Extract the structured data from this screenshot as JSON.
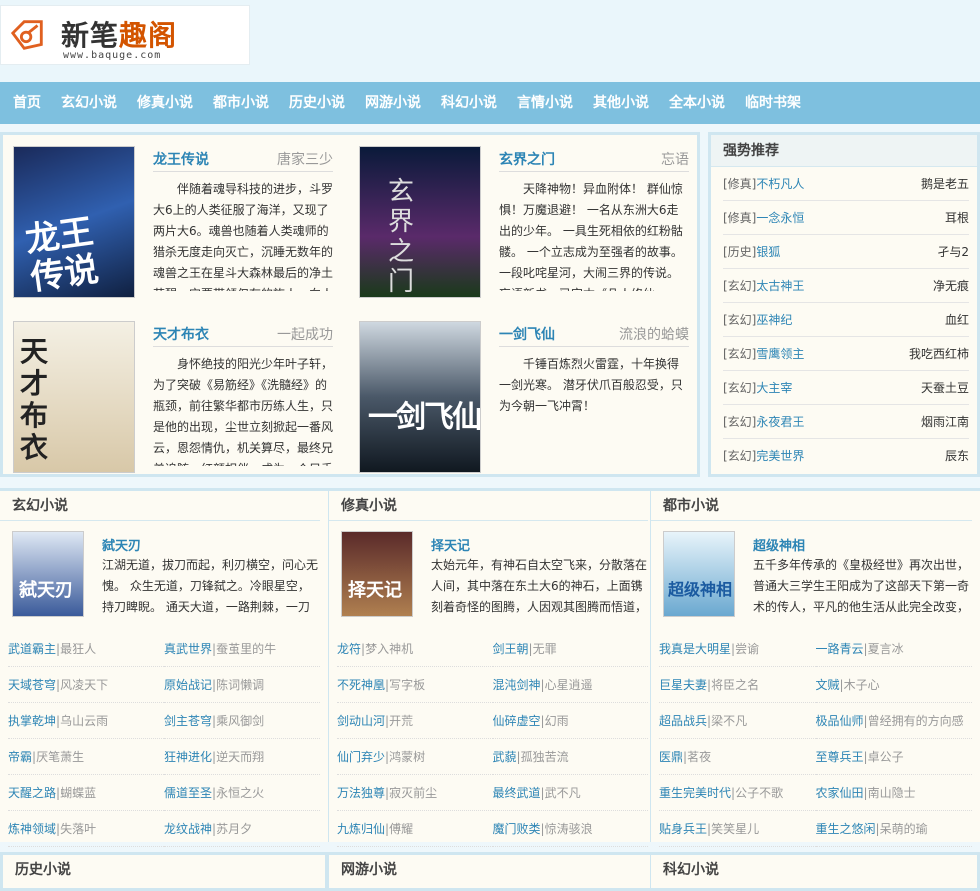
{
  "logo": {
    "text_a": "新笔",
    "text_b": "趣阁",
    "url": "www.baquge.com"
  },
  "nav": [
    "首页",
    "玄幻小说",
    "修真小说",
    "都市小说",
    "历史小说",
    "网游小说",
    "科幻小说",
    "言情小说",
    "其他小说",
    "全本小说",
    "临时书架"
  ],
  "featured": [
    {
      "title": "龙王传说",
      "author": "唐家三少",
      "desc": "伴随着魂导科技的进步，斗罗大6上的人类征服了海洋，又现了两片大6。魂兽也随着人类魂师的猎杀无度走向灭亡，沉睡无数年的魂兽之王在星斗大森林最后的净土苏醒，它要带领仅存的族人，向人类"
    },
    {
      "title": "玄界之门",
      "author": "忘语",
      "desc": "天降神物！异血附体！ 群仙惊惧！万魔退避！ 一名从东洲大6走出的少年。 一具生死相依的红粉骷髅。 一个立志成为至强者的故事。 一段叱咤星河，大闹三界的传说。 忘语新书，已完本《凡人修仙"
    },
    {
      "title": "天才布衣",
      "author": "一起成功",
      "desc": "身怀绝技的阳光少年叶子轩，为了突破《易筋经》《洗髓经》的瓶颈，前往繁华都市历练人生，只是他的出现，尘世立刻掀起一番风云，恩怨情仇，机关算尽，最终兄弟追随，红颜相伴，成为一个只手"
    },
    {
      "title": "一剑飞仙",
      "author": "流浪的蛤蟆",
      "desc": "千锤百炼烈火雷霆，十年换得一剑光寒。 潜牙伏爪百般忍受，只为今朝一飞冲霄！"
    }
  ],
  "recommend": {
    "heading": "强势推荐",
    "items": [
      {
        "tag": "[修真]",
        "name": "不朽凡人",
        "author": "鹅是老五"
      },
      {
        "tag": "[修真]",
        "name": "一念永恒",
        "author": "耳根"
      },
      {
        "tag": "[历史]",
        "name": "银狐",
        "author": "孑与2"
      },
      {
        "tag": "[玄幻]",
        "name": "太古神王",
        "author": "净无痕"
      },
      {
        "tag": "[玄幻]",
        "name": "巫神纪",
        "author": "血红"
      },
      {
        "tag": "[玄幻]",
        "name": "雪鹰领主",
        "author": "我吃西红柿"
      },
      {
        "tag": "[玄幻]",
        "name": "大主宰",
        "author": "天蚕土豆"
      },
      {
        "tag": "[玄幻]",
        "name": "永夜君王",
        "author": "烟雨江南"
      },
      {
        "tag": "[玄幻]",
        "name": "完美世界",
        "author": "辰东"
      }
    ]
  },
  "categories": [
    {
      "heading": "玄幻小说",
      "top": {
        "title": "弑天刃",
        "desc": "江湖无道，拔刀而起，利刃横空，问心无愧。 众生无道，刀锋弑之。冷眼星空，持刀睥睨。 通天大道，一路荆棘，一刀"
      },
      "list": [
        [
          "武道霸主",
          "最狂人"
        ],
        [
          "真武世界",
          "蚕茧里的牛"
        ],
        [
          "天域苍穹",
          "风凌天下"
        ],
        [
          "原始战记",
          "陈词懒调"
        ],
        [
          "执掌乾坤",
          "乌山云雨"
        ],
        [
          "剑主苍穹",
          "乘风御剑"
        ],
        [
          "帝霸",
          "厌笔萧生"
        ],
        [
          "狂神进化",
          "逆天而翔"
        ],
        [
          "天醒之路",
          "蝴蝶蓝"
        ],
        [
          "儒道至圣",
          "永恒之火"
        ],
        [
          "炼神领域",
          "失落叶"
        ],
        [
          "龙纹战神",
          "苏月夕"
        ]
      ]
    },
    {
      "heading": "修真小说",
      "top": {
        "title": "择天记",
        "desc": "太始元年，有神石自太空飞来，分散落在人间，其中落在东土大6的神石，上面镌刻着奇怪的图腾，人因观其图腾而悟道，"
      },
      "list": [
        [
          "龙符",
          "梦入神机"
        ],
        [
          "剑王朝",
          "无罪"
        ],
        [
          "不死神凰",
          "写字板"
        ],
        [
          "混沌剑神",
          "心星逍遥"
        ],
        [
          "剑动山河",
          "开荒"
        ],
        [
          "仙碎虚空",
          "幻雨"
        ],
        [
          "仙门弃少",
          "鸿蒙树"
        ],
        [
          "武藐",
          "孤独苦流"
        ],
        [
          "万法独尊",
          "寂灭前尘"
        ],
        [
          "最终武道",
          "武不凡"
        ],
        [
          "九炼归仙",
          "傅耀"
        ],
        [
          "魔门败类",
          "惊涛骇浪"
        ]
      ]
    },
    {
      "heading": "都市小说",
      "top": {
        "title": "超级神相",
        "desc": "五千多年传承的《皇极经世》再次出世，普通大三学生王阳成为了这部天下第一奇术的传人，平凡的他生活从此完全改变，"
      },
      "list": [
        [
          "我真是大明星",
          "尝谕"
        ],
        [
          "一路青云",
          "夏言冰"
        ],
        [
          "巨星夫妻",
          "将臣之名"
        ],
        [
          "文贼",
          "木子心"
        ],
        [
          "超品战兵",
          "梁不凡"
        ],
        [
          "极品仙师",
          "曾经拥有的方向感"
        ],
        [
          "医鼎",
          "茗夜"
        ],
        [
          "至尊兵王",
          "卓公子"
        ],
        [
          "重生完美时代",
          "公子不歌"
        ],
        [
          "农家仙田",
          "南山隐士"
        ],
        [
          "贴身兵王",
          "笑笑星儿"
        ],
        [
          "重生之悠闲",
          "呆萌的瑜"
        ]
      ]
    }
  ],
  "bottom_categories": [
    "历史小说",
    "网游小说",
    "科幻小说"
  ]
}
